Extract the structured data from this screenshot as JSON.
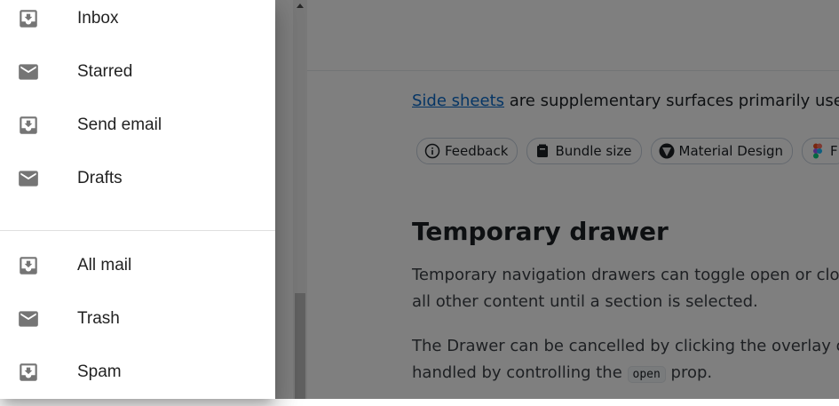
{
  "drawer": {
    "primary_items": [
      {
        "label": "Inbox",
        "icon": "inbox-icon"
      },
      {
        "label": "Starred",
        "icon": "mail-icon"
      },
      {
        "label": "Send email",
        "icon": "inbox-icon"
      },
      {
        "label": "Drafts",
        "icon": "mail-icon"
      }
    ],
    "secondary_items": [
      {
        "label": "All mail",
        "icon": "inbox-icon"
      },
      {
        "label": "Trash",
        "icon": "mail-icon"
      },
      {
        "label": "Spam",
        "icon": "inbox-icon"
      }
    ]
  },
  "page": {
    "intro_link": "Side sheets",
    "intro_text": " are supplementary surfaces primarily use",
    "chips": [
      {
        "label": "Feedback",
        "icon": "info-icon"
      },
      {
        "label": "Bundle size",
        "icon": "package-icon"
      },
      {
        "label": "Material Design",
        "icon": "material-icon"
      },
      {
        "label": "F",
        "icon": "figma-icon"
      }
    ],
    "section_title": "Temporary drawer",
    "para1_line1": "Temporary navigation drawers can toggle open or clos",
    "para1_line2": "all other content until a section is selected.",
    "para2_line1": "The Drawer can be cancelled by clicking the overlay or",
    "para2_line2_before": "handled by controlling the ",
    "para2_code": "open",
    "para2_line2_after": " prop."
  },
  "colors": {
    "backdrop": "#000000",
    "link": "#0b6bcb",
    "icon": "#757575"
  }
}
